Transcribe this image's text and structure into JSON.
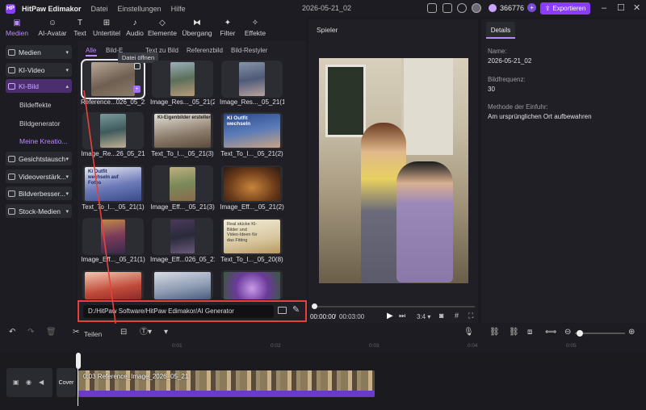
{
  "app": {
    "name": "HitPaw Edimakor",
    "logo": "HP"
  },
  "menu": [
    "Datei",
    "Einstellungen",
    "Hilfe"
  ],
  "document_title": "2026-05-21_02",
  "credits": "366776",
  "export_label": "Exportieren",
  "toolbar": [
    "Medien",
    "AI-Avatar",
    "Text",
    "Untertitel",
    "Audio",
    "Elemente",
    "Übergang",
    "Filter",
    "Effekte"
  ],
  "sidebar": {
    "items": [
      "Medien",
      "KI-Video",
      "KI-Bild",
      "Gesichtstausch",
      "Videoverstärk...",
      "Bildverbesser...",
      "Stock-Medien"
    ],
    "sub_items": [
      "Bildeffekte",
      "Bildgenerator",
      "Meine Kreatio..."
    ]
  },
  "filter_tabs": [
    "Alle",
    "Bild-E",
    "Text zu Bild",
    "Referenzbild",
    "Bild-Restyler"
  ],
  "tooltip": "Datei öffnen",
  "media_items": [
    {
      "label": "Reference...026_05_21"
    },
    {
      "label": "Image_Res..._05_21(2)"
    },
    {
      "label": "Image_Res..._05_21(1)"
    },
    {
      "label": "Image_Re...26_05_21"
    },
    {
      "label": "Text_To_I..._05_21(3)"
    },
    {
      "label": "Text_To_I..._05_21(2)"
    },
    {
      "label": "Text_To_I..._05_21(1)"
    },
    {
      "label": "Image_Eff..._05_21(3)"
    },
    {
      "label": "Image_Eff..._05_21(2)"
    },
    {
      "label": "Image_Eff..._05_21(1)"
    },
    {
      "label": "Image_Eff...026_05_21"
    },
    {
      "label": "Text_To_I..._05_20(8)"
    },
    {
      "label": ""
    },
    {
      "label": ""
    },
    {
      "label": ""
    }
  ],
  "thumb_texts": {
    "t5": "KI-Eigenbilder erstellen",
    "t6": "KI Outfit wechseln",
    "t7": "KI Outfit wechseln auf Fotos",
    "t12": "Real stücke KI-Bilder und Video-Ideen für das Fitting"
  },
  "path": "D:/HitPaw Software/HitPaw Edimakor/AI Generator",
  "player": {
    "header": "Spieler",
    "time_current": "00:00:00",
    "time_total": "00:03:00",
    "ratio": "3:4"
  },
  "details": {
    "tab": "Details",
    "name_label": "Name:",
    "name_value": "2026-05-21_02",
    "fps_label": "Bildfrequenz:",
    "fps_value": "30",
    "method_label": "Methode der Einfuhr:",
    "method_value": "Am ursprünglichen Ort aufbewahren"
  },
  "timeline": {
    "split_label": "Teilen",
    "ticks": [
      "0:01",
      "0:02",
      "0:03",
      "0:04",
      "0:05"
    ],
    "cover_label": "Cover",
    "clip_label": "0:03 Reference_Image_2026_05_21"
  }
}
